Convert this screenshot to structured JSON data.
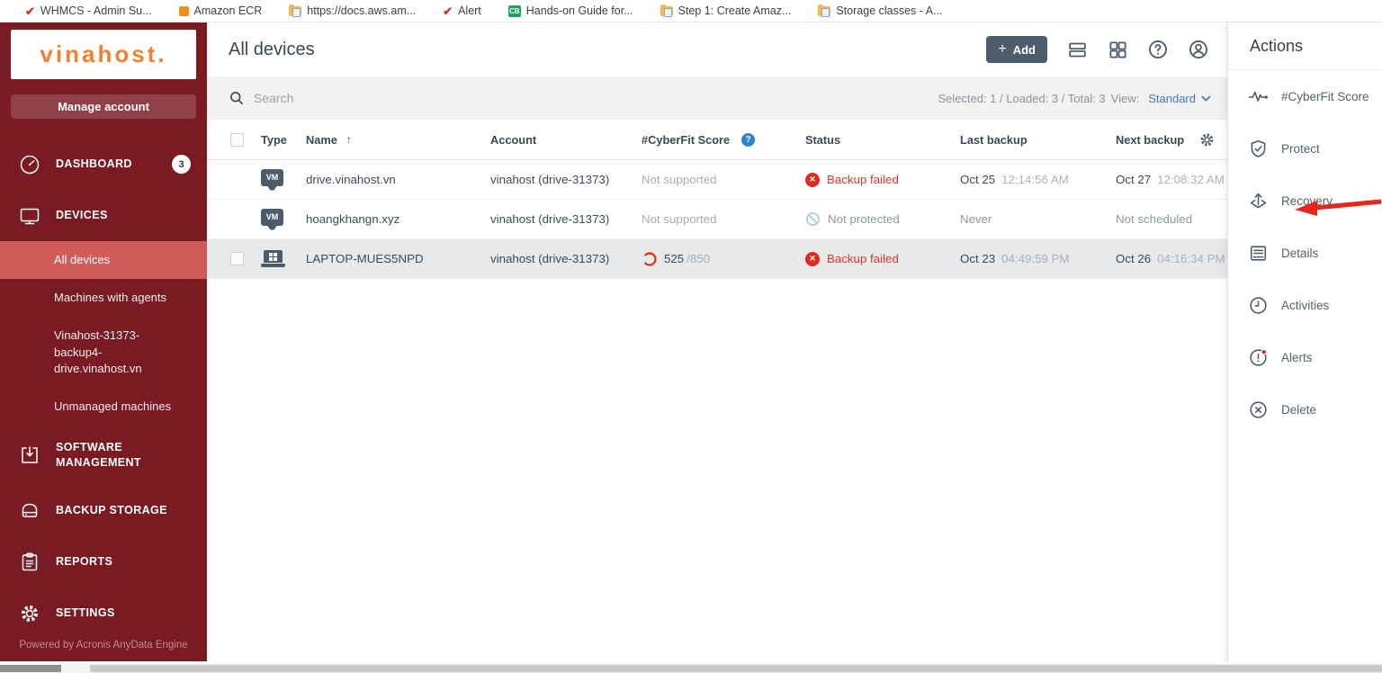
{
  "bookmarks_bar": {
    "items": [
      {
        "label": "WHMCS - Admin Su...",
        "icon": "check-icon"
      },
      {
        "label": "Amazon ECR",
        "icon": "cube-icon"
      },
      {
        "label": "https://docs.aws.am...",
        "icon": "folder-icon"
      },
      {
        "label": "Alert",
        "icon": "check-icon"
      },
      {
        "label": "Hands-on Guide for...",
        "icon": "cb-badge-icon",
        "badge": "CB"
      },
      {
        "label": "Step 1: Create Amaz...",
        "icon": "folder-icon"
      },
      {
        "label": "Storage classes - A...",
        "icon": "folder-icon"
      }
    ]
  },
  "sidebar": {
    "logo_text": "vinahost.",
    "manage_account_label": "Manage account",
    "dashboard": {
      "label": "DASHBOARD",
      "badge": "3"
    },
    "devices": {
      "label": "DEVICES",
      "children": [
        {
          "label": "All devices"
        },
        {
          "label": "Machines with agents"
        },
        {
          "label": "Vinahost-31373-backup4-drive.vinahost.vn"
        },
        {
          "label": "Unmanaged machines"
        }
      ]
    },
    "software_management_label": "SOFTWARE MANAGEMENT",
    "backup_storage_label": "BACKUP STORAGE",
    "reports_label": "REPORTS",
    "settings_label": "SETTINGS",
    "footer": "Powered by Acronis AnyData Engine"
  },
  "header": {
    "title": "All devices",
    "add_button": {
      "plus": "+",
      "label": "Add"
    }
  },
  "toolbar": {
    "search_placeholder": "Search",
    "selection_summary": "Selected: 1 / Loaded: 3 / Total: 3",
    "view_label": "View:",
    "view_value": "Standard"
  },
  "table": {
    "vm_label": "VM",
    "sort_arrow": "↑",
    "headers": {
      "type": "Type",
      "name": "Name",
      "account": "Account",
      "cyberfit": "#CyberFit Score",
      "status": "Status",
      "last_backup": "Last backup",
      "next_backup": "Next backup"
    },
    "rows": [
      {
        "type_icon": "vm-icon",
        "name": "drive.vinahost.vn",
        "account": "vinahost (drive-31373)",
        "cyberfit": "Not supported",
        "status": "Backup failed",
        "last_date": "Oct 25",
        "last_time": "12:14:56 AM",
        "next_date": "Oct 27",
        "next_time": "12:08:32 AM"
      },
      {
        "type_icon": "vm-icon",
        "name": "hoangkhangn.xyz",
        "account": "vinahost (drive-31373)",
        "cyberfit": "Not supported",
        "status": "Not protected",
        "last_text": "Never",
        "next_text": "Not scheduled"
      },
      {
        "type_icon": "laptop-icon",
        "name": "LAPTOP-MUES5NPD",
        "account": "vinahost (drive-31373)",
        "cyberfit_score": "525",
        "cyberfit_total": "/850",
        "status": "Backup failed",
        "last_date": "Oct 23",
        "last_time": "04:49:59 PM",
        "next_date": "Oct 26",
        "next_time": "04:16:34 PM"
      }
    ]
  },
  "actions_panel": {
    "title": "Actions",
    "items": [
      {
        "label": "#CyberFit Score",
        "icon": "pulse-icon"
      },
      {
        "label": "Protect",
        "icon": "shield-check-icon"
      },
      {
        "label": "Recovery",
        "icon": "recovery-icon"
      },
      {
        "label": "Details",
        "icon": "details-icon"
      },
      {
        "label": "Activities",
        "icon": "clock-icon"
      },
      {
        "label": "Alerts",
        "icon": "alert-icon"
      },
      {
        "label": "Delete",
        "icon": "delete-icon"
      }
    ]
  },
  "colors": {
    "sidebar_bg": "#7a1a22",
    "sidebar_active_bg": "#d15b59",
    "brand_orange": "#ef8232",
    "error_red": "#de2b20",
    "link_blue": "#3f79c0",
    "slate": "#4d5c6b",
    "help_blue": "#2f80d0"
  }
}
